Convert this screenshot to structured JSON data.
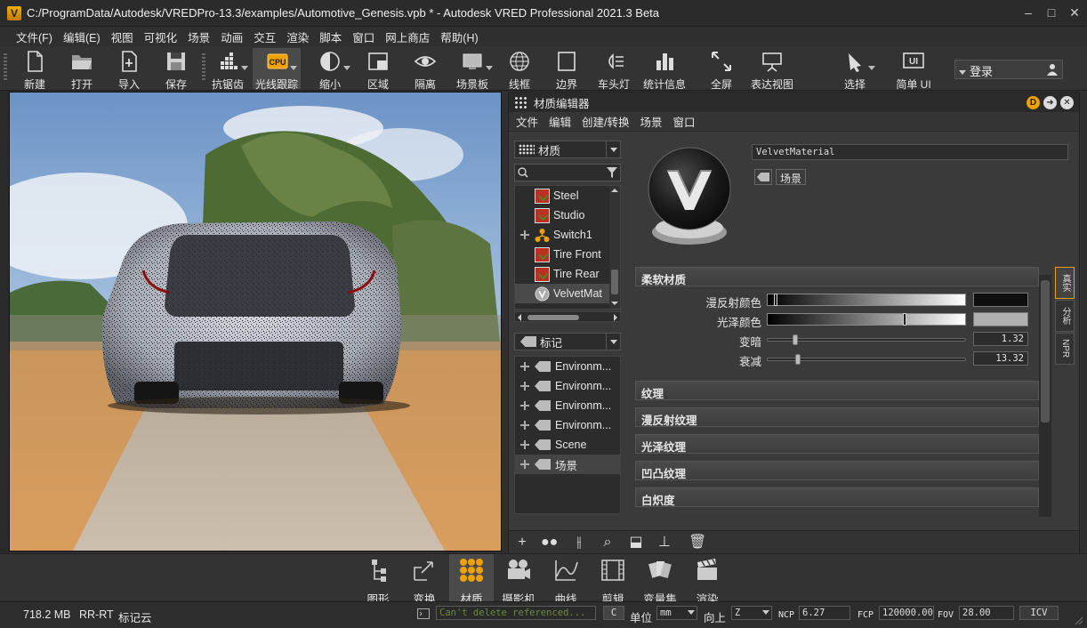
{
  "window": {
    "title": "C:/ProgramData/Autodesk/VREDPro-13.3/examples/Automotive_Genesis.vpb * - Autodesk VRED Professional 2021.3 Beta",
    "logo_letter": "V"
  },
  "menu": [
    "文件(F)",
    "编辑(E)",
    "视图",
    "可视化",
    "场景",
    "动画",
    "交互",
    "渲染",
    "脚本",
    "窗口",
    "网上商店",
    "帮助(H)"
  ],
  "toolbar": {
    "items": [
      {
        "label": "新建",
        "icon": "new-file-icon"
      },
      {
        "label": "打开",
        "icon": "folder-open-icon"
      },
      {
        "label": "导入",
        "icon": "import-icon"
      },
      {
        "label": "保存",
        "icon": "save-icon"
      },
      {
        "label": "抗锯齿",
        "icon": "antialiasing-icon"
      },
      {
        "label": "光线跟踪",
        "icon": "cpu-icon",
        "icon_text": "CPU"
      },
      {
        "label": "缩小",
        "icon": "downscale-icon"
      },
      {
        "label": "区域",
        "icon": "region-icon"
      },
      {
        "label": "隔离",
        "icon": "isolate-eye-icon"
      },
      {
        "label": "场景板",
        "icon": "sceneplate-icon"
      },
      {
        "label": "线框",
        "icon": "wireframe-sphere-icon"
      },
      {
        "label": "边界",
        "icon": "bounding-box-icon"
      },
      {
        "label": "车头灯",
        "icon": "headlight-icon"
      },
      {
        "label": "统计信息",
        "icon": "statistics-icon"
      },
      {
        "label": "全屏",
        "icon": "fullscreen-icon"
      },
      {
        "label": "表达视图",
        "icon": "presentation-icon"
      },
      {
        "label": "选择",
        "icon": "select-icon"
      },
      {
        "label": "简单 UI",
        "icon": "simple-ui-icon",
        "icon_text": "UI"
      }
    ],
    "login": "登录"
  },
  "material_editor": {
    "title": "材质编辑器",
    "menu": [
      "文件",
      "编辑",
      "创建/转换",
      "场景",
      "窗口"
    ],
    "materials_combo": "材质",
    "tree": [
      {
        "name": "Steel",
        "icon": "material-icon",
        "expand": false
      },
      {
        "name": "Studio",
        "icon": "material-icon",
        "expand": false
      },
      {
        "name": "Switch1",
        "icon": "switch-icon",
        "expand": true
      },
      {
        "name": "Tire Front",
        "icon": "material-icon",
        "expand": false
      },
      {
        "name": "Tire Rear",
        "icon": "material-icon",
        "expand": false
      },
      {
        "name": "VelvetMat",
        "icon": "velvet-icon",
        "expand": false,
        "selected": true
      }
    ],
    "tags_combo": "标记",
    "tags": [
      {
        "name": "Environm..."
      },
      {
        "name": "Environm..."
      },
      {
        "name": "Environm..."
      },
      {
        "name": "Environm..."
      },
      {
        "name": "Scene"
      },
      {
        "name": "场景",
        "selected": true
      }
    ],
    "material_name": "VelvetMaterial",
    "scene_tag": "场景",
    "section_title": "柔软材质",
    "properties": [
      {
        "label": "漫反射颜色",
        "type": "color",
        "gradient_marker": 0.03,
        "swatch": "#0e0e0e"
      },
      {
        "label": "光泽颜色",
        "type": "color",
        "gradient_marker": 0.69,
        "swatch": "#b0b0b0"
      },
      {
        "label": "变暗",
        "type": "number",
        "value": "1.32",
        "slider": 0.13
      },
      {
        "label": "衰减",
        "type": "number",
        "value": "13.32",
        "slider": 0.14
      }
    ],
    "sections": [
      "纹理",
      "漫反射纹理",
      "光泽纹理",
      "凹凸纹理",
      "白炽度"
    ],
    "side_tabs": [
      "真实",
      "分析",
      "NPR"
    ]
  },
  "modules": [
    {
      "label": "图形",
      "icon": "graph-icon"
    },
    {
      "label": "变换",
      "icon": "transform-icon"
    },
    {
      "label": "材质",
      "icon": "materials-icon",
      "active": true
    },
    {
      "label": "摄影机",
      "icon": "camera-icon"
    },
    {
      "label": "曲线",
      "icon": "curves-icon"
    },
    {
      "label": "剪辑",
      "icon": "clips-icon"
    },
    {
      "label": "变量集",
      "icon": "variant-sets-icon"
    },
    {
      "label": "渲染",
      "icon": "render-clapper-icon"
    }
  ],
  "status": {
    "memory": "718.2 MB",
    "render_mode": "RR-RT",
    "cloud": "标记云",
    "message": "Can't delete referenced...",
    "clear_btn": "C",
    "unit_label": "单位",
    "unit_value": "mm",
    "up_label": "向上",
    "up_value": "Z",
    "ncp_label": "NCP",
    "ncp_value": "6.27",
    "fcp_label": "FCP",
    "fcp_value": "120000.00",
    "fov_label": "FOV",
    "fov_value": "28.00",
    "icv": "ICV"
  },
  "colors": {
    "accent": "#f0a000",
    "ok_green": "#2f9e2f",
    "error_text": "#6a8a3a"
  }
}
